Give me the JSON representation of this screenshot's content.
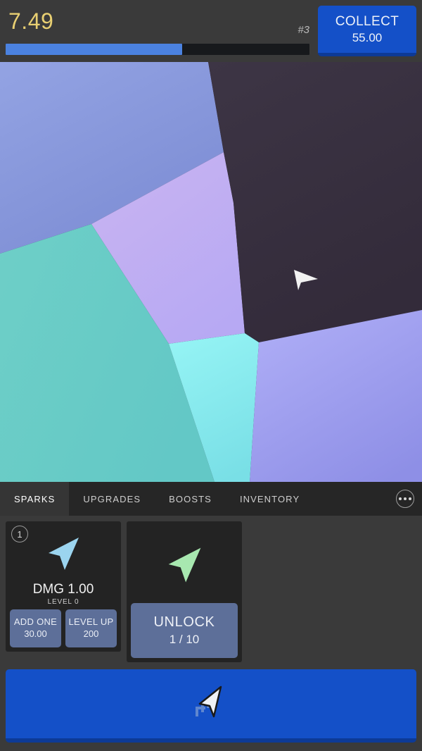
{
  "header": {
    "score": "7.49",
    "rank": "#3",
    "progress_percent": 58,
    "collect": {
      "label": "COLLECT",
      "value": "55.00"
    },
    "colors": {
      "score": "#e8cf72",
      "progress_fill": "#4b82e0",
      "collect_bg": "#1450c8"
    }
  },
  "stage": {
    "cursor_icon": "arrow-right-cursor",
    "cells": [
      {
        "name": "cell-blue-top-left",
        "fill_from": "#8d9ede",
        "fill_to": "#7f8fd6"
      },
      {
        "name": "cell-lavender-center",
        "fill_from": "#c3aef0",
        "fill_to": "#b9aaf2"
      },
      {
        "name": "cell-dark-right",
        "fill_from": "#3b3342",
        "fill_to": "#332c3b"
      },
      {
        "name": "cell-teal-bottom-left",
        "fill_from": "#6fd0c8",
        "fill_to": "#5fc3bd"
      },
      {
        "name": "cell-cyan-bottom-center",
        "fill_from": "#8ff0f2",
        "fill_to": "#7ee6ea"
      },
      {
        "name": "cell-periwinkle-bottom-right",
        "fill_from": "#a9a8f4",
        "fill_to": "#8f90e6"
      }
    ]
  },
  "tabs": [
    {
      "label": "SPARKS",
      "active": true
    },
    {
      "label": "UPGRADES",
      "active": false
    },
    {
      "label": "BOOSTS",
      "active": false
    },
    {
      "label": "INVENTORY",
      "active": false
    }
  ],
  "more_menu": {
    "icon": "ellipsis-icon"
  },
  "cards": [
    {
      "badge": "1",
      "art_icon": "arrow-cursor-blue",
      "art_color": "#9bd4ef",
      "title": "DMG 1.00",
      "subtitle": "LEVEL 0",
      "buttons": [
        {
          "label": "ADD ONE",
          "value": "30.00"
        },
        {
          "label": "LEVEL UP",
          "value": "200"
        }
      ]
    },
    {
      "art_icon": "arrow-cursor-green",
      "art_color": "#a8e8b0",
      "unlock": {
        "label": "UNLOCK",
        "value": "1 / 10"
      }
    }
  ],
  "action_bar": {
    "icon": "cursor-trail-icon",
    "color": "#1450c8"
  }
}
